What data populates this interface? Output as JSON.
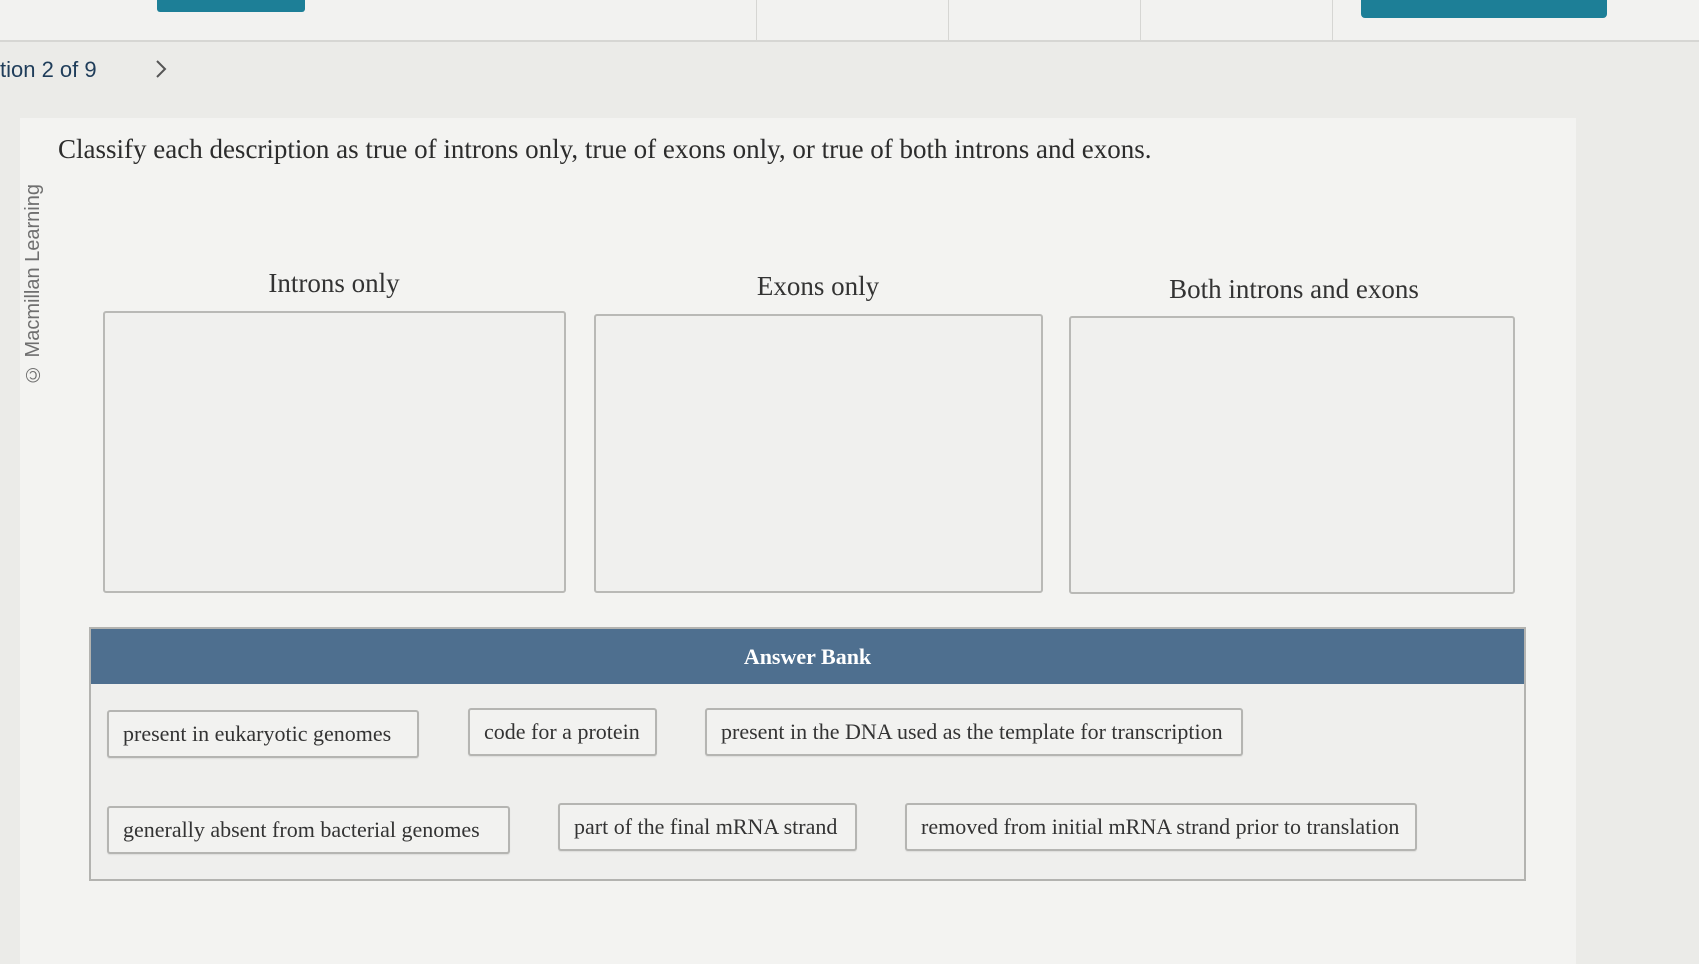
{
  "navigation": {
    "question_label": "tion 2 of 9"
  },
  "copyright": "© Macmillan Learning",
  "prompt": "Classify each description as true of introns only, true of exons only, or true of both introns and exons.",
  "bins": [
    {
      "title": "Introns only"
    },
    {
      "title": "Exons only"
    },
    {
      "title": "Both introns and exons"
    }
  ],
  "answer_bank": {
    "title": "Answer Bank",
    "items": [
      "present in eukaryotic genomes",
      "code for a protein",
      "present in the DNA used as the template for transcription",
      "generally absent from bacterial genomes",
      "part of the final mRNA strand",
      "removed from initial mRNA strand prior to translation"
    ]
  },
  "colors": {
    "answer_bank_header": "#4e6f8f",
    "toolbar_button": "#1d7f97",
    "nav_text": "#1f3d5a"
  }
}
